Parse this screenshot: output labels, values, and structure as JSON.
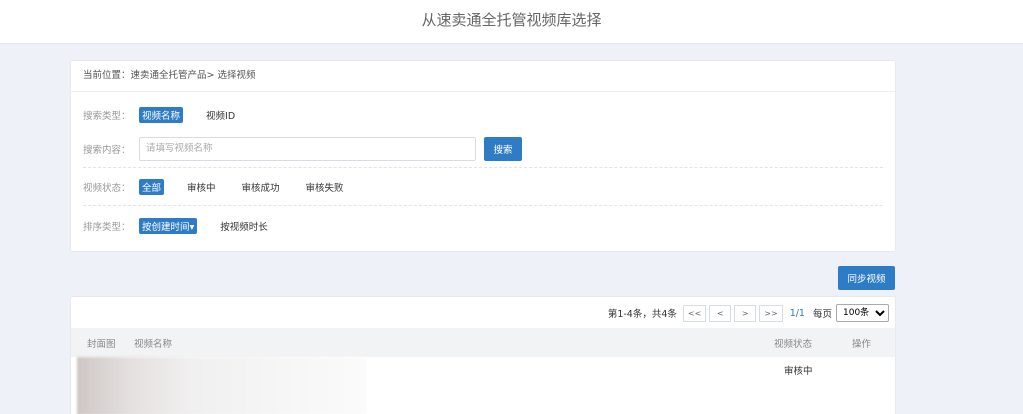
{
  "header": {
    "title": "从速卖通全托管视频库选择"
  },
  "breadcrumb": {
    "label": "当前位置：",
    "path": "速卖通全托管产品> 选择视频"
  },
  "filters": {
    "search_type": {
      "label": "搜索类型：",
      "options": [
        "视频名称",
        "视频ID"
      ],
      "active": 0
    },
    "search_content": {
      "label": "搜索内容：",
      "placeholder": "请填写视频名称",
      "value": "",
      "button": "搜索"
    },
    "video_status": {
      "label": "视频状态：",
      "options": [
        "全部",
        "审核中",
        "审核成功",
        "审核失败"
      ],
      "active": 0
    },
    "sort_type": {
      "label": "排序类型：",
      "options": [
        "按创建时间",
        "按视频时长"
      ],
      "active": 0,
      "active_arrow": "▾"
    }
  },
  "sync_button": "同步视频",
  "pager": {
    "total": "第1-4条，共4条",
    "first": "<<",
    "prev": "<",
    "next": ">",
    "last": ">>",
    "page_info": "1/1",
    "per_page_label": "每页",
    "per_page_value": "100条"
  },
  "table": {
    "headers": {
      "cover": "封面图",
      "name": "视频名称",
      "status": "视频状态",
      "actions": "操作"
    },
    "rows": [
      {
        "status": "审核中"
      }
    ]
  },
  "colors": {
    "accent": "#2f7cc6",
    "background": "#eef1f7"
  }
}
